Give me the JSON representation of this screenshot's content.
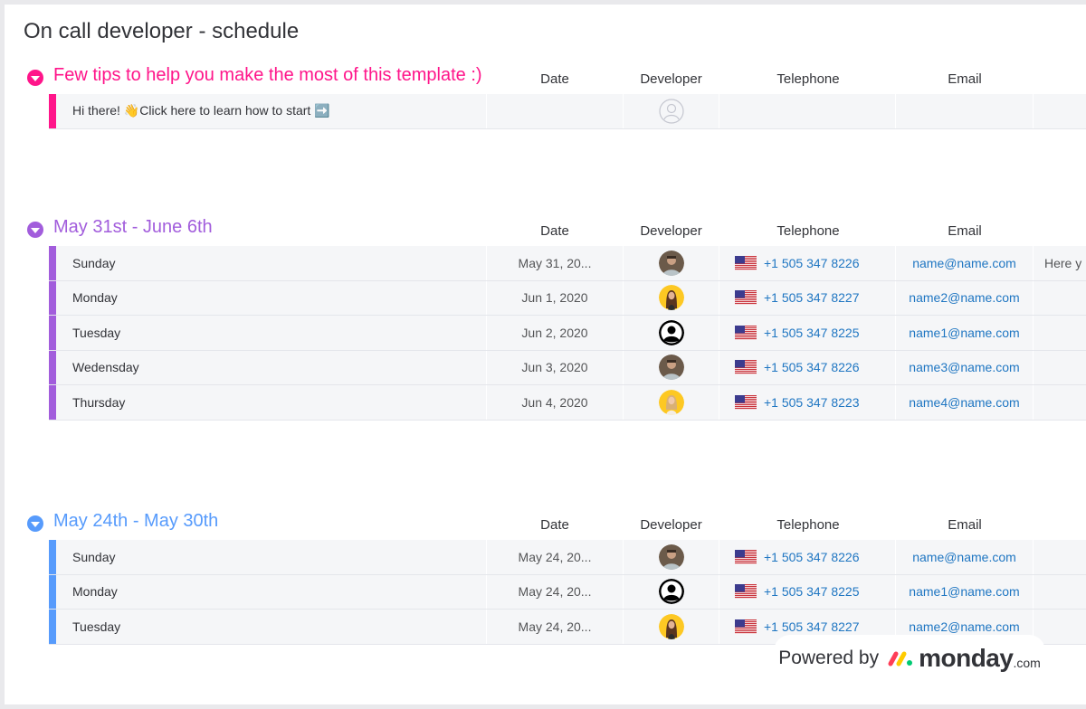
{
  "board": {
    "title": "On call developer - schedule"
  },
  "columns": {
    "date": "Date",
    "developer": "Developer",
    "telephone": "Telephone",
    "email": "Email"
  },
  "colors": {
    "pink": "#ff158a",
    "purple": "#a25ddc",
    "blue": "#579bfc",
    "link": "#1f76c2"
  },
  "groups": [
    {
      "title": "Few tips to help you make the most of this template :)",
      "color": "#ff158a",
      "rows": [
        {
          "name": "Hi there! 👋Click here to learn how to start ➡️",
          "date": "",
          "developer": "empty",
          "telephone": "",
          "email": "",
          "extra": ""
        }
      ]
    },
    {
      "title": "May 31st - June 6th",
      "color": "#a25ddc",
      "rows": [
        {
          "name": "Sunday",
          "date": "May 31, 20...",
          "developer": "man",
          "telephone": "+1 505 347 8226",
          "email": "name@name.com",
          "extra": "Here y"
        },
        {
          "name": "Monday",
          "date": "Jun 1, 2020",
          "developer": "woman1",
          "telephone": "+1 505 347 8227",
          "email": "name2@name.com",
          "extra": ""
        },
        {
          "name": "Tuesday",
          "date": "Jun 2, 2020",
          "developer": "default",
          "telephone": "+1 505 347 8225",
          "email": "name1@name.com",
          "extra": ""
        },
        {
          "name": "Wedensday",
          "date": "Jun 3, 2020",
          "developer": "man",
          "telephone": "+1 505 347 8226",
          "email": "name3@name.com",
          "extra": ""
        },
        {
          "name": "Thursday",
          "date": "Jun 4, 2020",
          "developer": "woman2",
          "telephone": "+1 505 347 8223",
          "email": "name4@name.com",
          "extra": ""
        }
      ]
    },
    {
      "title": "May 24th - May 30th",
      "color": "#579bfc",
      "rows": [
        {
          "name": "Sunday",
          "date": "May 24, 20...",
          "developer": "man",
          "telephone": "+1 505 347 8226",
          "email": "name@name.com",
          "extra": ""
        },
        {
          "name": "Monday",
          "date": "May 24, 20...",
          "developer": "default",
          "telephone": "+1 505 347 8225",
          "email": "name1@name.com",
          "extra": ""
        },
        {
          "name": "Tuesday",
          "date": "May 24, 20...",
          "developer": "woman1",
          "telephone": "+1 505 347 8227",
          "email": "name2@name.com",
          "extra": ""
        }
      ]
    }
  ],
  "footer": {
    "powered_by": "Powered by",
    "brand": "monday",
    "brand_suffix": ".com"
  }
}
